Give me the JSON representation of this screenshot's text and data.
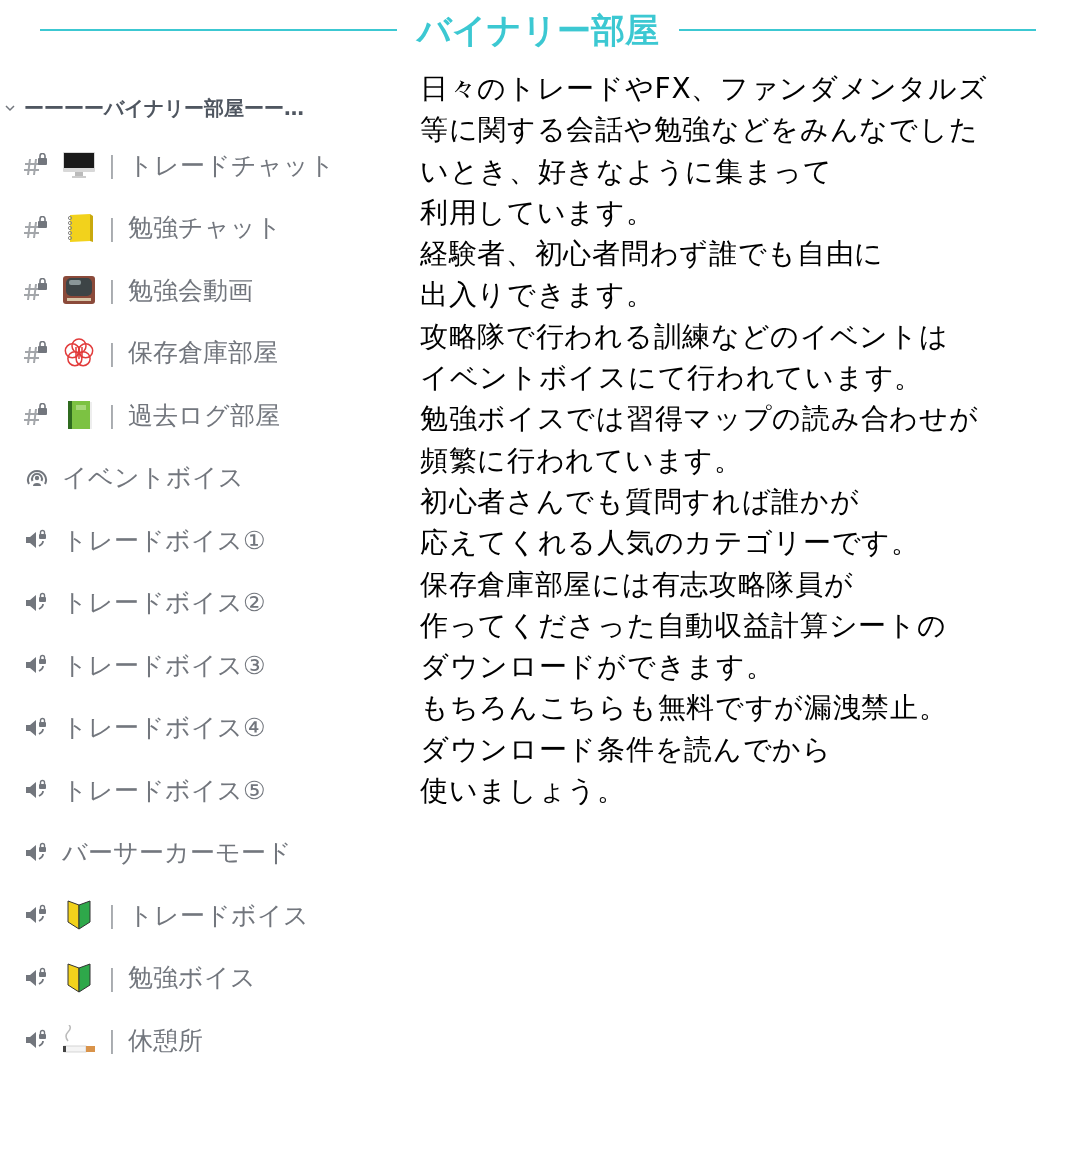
{
  "title": "バイナリー部屋",
  "sidebar": {
    "category": {
      "label": "ーーーーバイナリー部屋ーー…",
      "expanded": true
    },
    "channels": [
      {
        "kind": "text-locked",
        "separator": "｜",
        "label": "トレードチャット"
      },
      {
        "kind": "text-locked",
        "separator": "｜",
        "label": "勉強チャット"
      },
      {
        "kind": "text-locked",
        "separator": "｜",
        "label": "勉強会動画"
      },
      {
        "kind": "text-locked",
        "separator": "｜",
        "label": "保存倉庫部屋"
      },
      {
        "kind": "text-locked",
        "separator": "｜",
        "label": "過去ログ部屋"
      },
      {
        "kind": "stage",
        "label": "イベントボイス"
      },
      {
        "kind": "voice-locked",
        "label": "トレードボイス①"
      },
      {
        "kind": "voice-locked",
        "label": "トレードボイス②"
      },
      {
        "kind": "voice-locked",
        "label": "トレードボイス③"
      },
      {
        "kind": "voice-locked",
        "label": "トレードボイス④"
      },
      {
        "kind": "voice-locked",
        "label": "トレードボイス⑤"
      },
      {
        "kind": "voice-locked",
        "label": "バーサーカーモード"
      },
      {
        "kind": "voice-locked",
        "separator": "｜",
        "label": "トレードボイス"
      },
      {
        "kind": "voice-locked",
        "separator": "｜",
        "label": "勉強ボイス"
      },
      {
        "kind": "voice-locked",
        "separator": "｜",
        "label": "休憩所"
      }
    ]
  },
  "description": [
    "日々のトレードやFX、ファンダメンタルズ",
    "等に関する会話や勉強などをみんなでした",
    "いとき、好きなように集まって",
    "利用しています。",
    "経験者、初心者問わず誰でも自由に",
    "出入りできます。",
    "攻略隊で行われる訓練などのイベントは",
    "イベントボイスにて行われています。",
    "勉強ボイスでは習得マップの読み合わせが",
    "頻繁に行われています。",
    "初心者さんでも質問すれば誰かが",
    "応えてくれる人気のカテゴリーです。",
    "保存倉庫部屋には有志攻略隊員が",
    "作ってくださった自動収益計算シートの",
    "ダウンロードができます。",
    "もちろんこちらも無料ですが漏洩禁止。",
    "ダウンロード条件を読んでから",
    "使いましょう。"
  ]
}
